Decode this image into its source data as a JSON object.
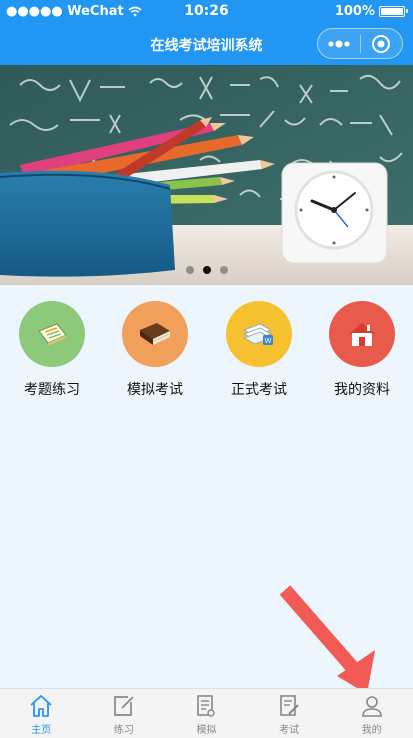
{
  "status_bar": {
    "carrier": "●●●●● WeChat",
    "time": "10:26",
    "battery": "100%"
  },
  "nav": {
    "title": "在线考试培训系统"
  },
  "banner": {
    "slide_count": 3,
    "active_slide": 2
  },
  "menu": {
    "items": [
      {
        "label": "考题练习",
        "color": "#8dc97b",
        "icon": "notebook-icon"
      },
      {
        "label": "模拟考试",
        "color": "#f0a05a",
        "icon": "book-icon"
      },
      {
        "label": "正式考试",
        "color": "#f5c12e",
        "icon": "document-stack-icon"
      },
      {
        "label": "我的资料",
        "color": "#e85a4b",
        "icon": "house-icon"
      }
    ]
  },
  "tabbar": {
    "items": [
      {
        "label": "主页",
        "icon": "home-icon",
        "active": true
      },
      {
        "label": "练习",
        "icon": "edit-icon",
        "active": false
      },
      {
        "label": "模拟",
        "icon": "document-icon",
        "active": false
      },
      {
        "label": "考试",
        "icon": "exam-icon",
        "active": false
      },
      {
        "label": "我的",
        "icon": "user-icon",
        "active": false
      }
    ]
  },
  "colors": {
    "primary": "#2196f3",
    "page_bg": "#eef6fd",
    "annotation_arrow": "#f25a55"
  }
}
